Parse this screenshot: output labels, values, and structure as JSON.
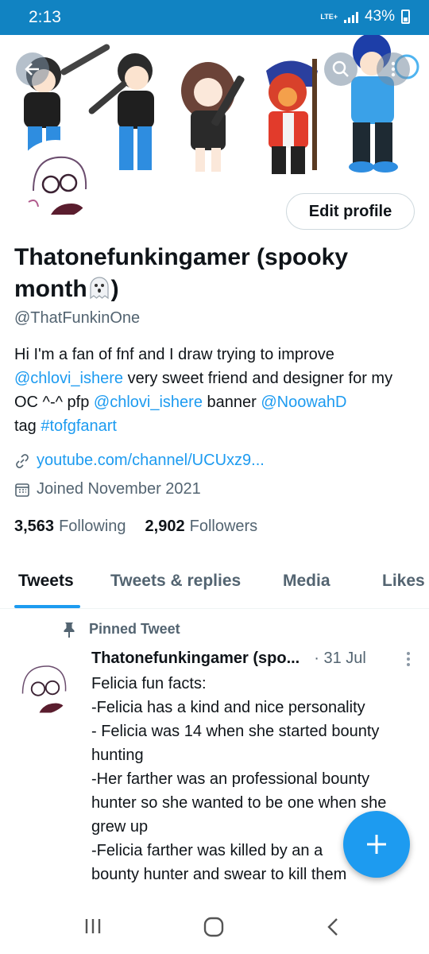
{
  "status_bar": {
    "time": "2:13",
    "network": "LTE+",
    "battery": "43%"
  },
  "profile": {
    "edit_label": "Edit profile",
    "display_name": "Thatonefunkingamer (spooky month",
    "display_name_end": ")",
    "handle": "@ThatFunkinOne",
    "bio": {
      "t1": "Hi I'm a fan of fnf and I draw trying to improve ",
      "m1": "@chlovi_ishere",
      "t2": " very sweet friend and designer for my OC ^-^ pfp ",
      "m2": "@chlovi_ishere",
      "t3": " banner ",
      "m3": "@NoowahD",
      "t4": " tag ",
      "h1": "#tofgfanart"
    },
    "url": "youtube.com/channel/UCUxz9...",
    "joined": "Joined November 2021",
    "following_count": "3,563",
    "following_label": "Following",
    "followers_count": "2,902",
    "followers_label": "Followers"
  },
  "tabs": [
    "Tweets",
    "Tweets & replies",
    "Media",
    "Likes"
  ],
  "active_tab": "Tweets",
  "pinned_tweet": {
    "pinned_label": "Pinned Tweet",
    "author": "Thatonefunkingamer (spo...",
    "date": "· 31 Jul",
    "lines": [
      "Felicia fun facts:",
      "-Felicia has a kind and nice personality",
      "- Felicia was 14 when she started bounty hunting",
      "-Her farther was an professional bounty hunter so she wanted to be one when she grew up",
      "-Felicia farther was killed by an a",
      "bounty hunter and swear to kill them"
    ]
  },
  "icons": {
    "back": "arrow-left-icon",
    "search": "search-icon",
    "more": "more-vertical-icon",
    "link": "link-icon",
    "calendar": "calendar-icon",
    "pin": "pin-icon",
    "compose": "plus-icon",
    "nav_recents": "recents-icon",
    "nav_home": "home-icon",
    "nav_back": "chevron-left-icon"
  },
  "colors": {
    "accent": "#1d9bf0",
    "status_bar": "#1183c2",
    "secondary_text": "#536471"
  }
}
